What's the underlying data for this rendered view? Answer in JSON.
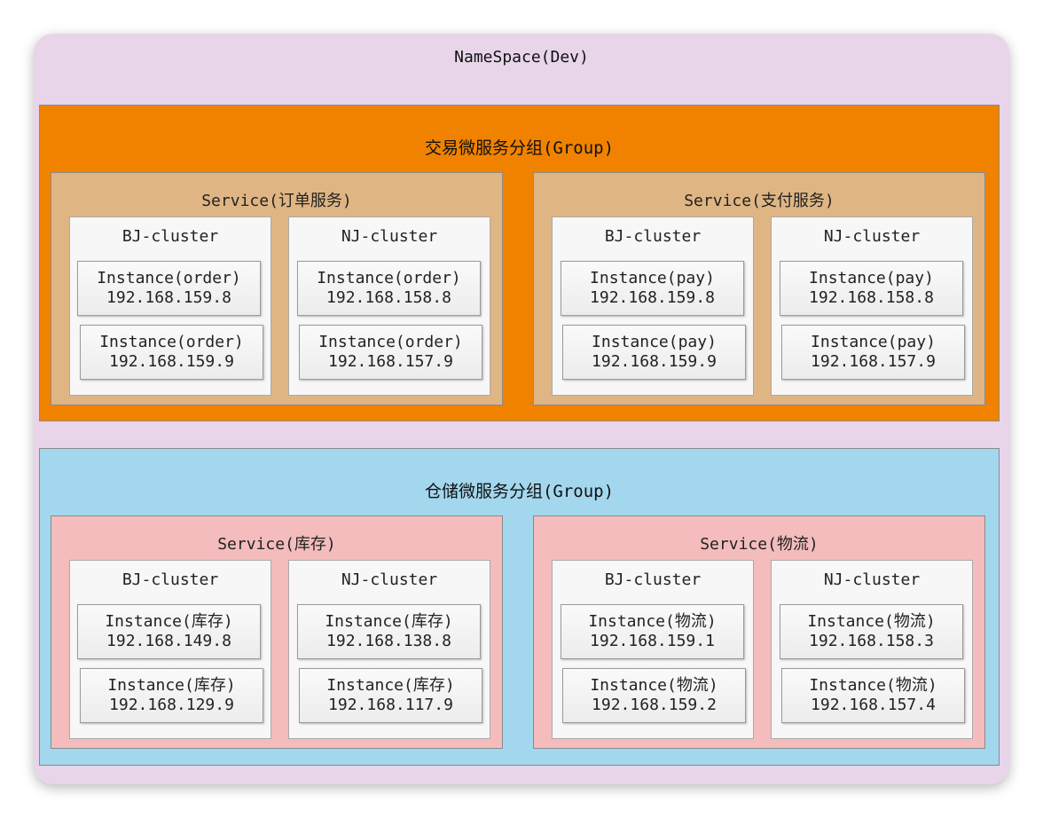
{
  "namespace": {
    "title": "NameSpace(Dev)"
  },
  "groups": [
    {
      "title": "交易微服务分组(Group)",
      "color": "#f08200",
      "service_color": "#dfb584",
      "services": [
        {
          "title": "Service(订单服务)",
          "clusters": [
            {
              "title": "BJ-cluster",
              "instances": [
                {
                  "name": "Instance(order)",
                  "ip": "192.168.159.8"
                },
                {
                  "name": "Instance(order)",
                  "ip": "192.168.159.9"
                }
              ]
            },
            {
              "title": "NJ-cluster",
              "instances": [
                {
                  "name": "Instance(order)",
                  "ip": "192.168.158.8"
                },
                {
                  "name": "Instance(order)",
                  "ip": "192.168.157.9"
                }
              ]
            }
          ]
        },
        {
          "title": "Service(支付服务)",
          "clusters": [
            {
              "title": "BJ-cluster",
              "instances": [
                {
                  "name": "Instance(pay)",
                  "ip": "192.168.159.8"
                },
                {
                  "name": "Instance(pay)",
                  "ip": "192.168.159.9"
                }
              ]
            },
            {
              "title": "NJ-cluster",
              "instances": [
                {
                  "name": "Instance(pay)",
                  "ip": "192.168.158.8"
                },
                {
                  "name": "Instance(pay)",
                  "ip": "192.168.157.9"
                }
              ]
            }
          ]
        }
      ]
    },
    {
      "title": "仓储微服务分组(Group)",
      "color": "#a3d7ee",
      "service_color": "#f4bcbc",
      "services": [
        {
          "title": "Service(库存)",
          "clusters": [
            {
              "title": "BJ-cluster",
              "instances": [
                {
                  "name": "Instance(库存)",
                  "ip": "192.168.149.8"
                },
                {
                  "name": "Instance(库存)",
                  "ip": "192.168.129.9"
                }
              ]
            },
            {
              "title": "NJ-cluster",
              "instances": [
                {
                  "name": "Instance(库存)",
                  "ip": "192.168.138.8"
                },
                {
                  "name": "Instance(库存)",
                  "ip": "192.168.117.9"
                }
              ]
            }
          ]
        },
        {
          "title": "Service(物流)",
          "clusters": [
            {
              "title": "BJ-cluster",
              "instances": [
                {
                  "name": "Instance(物流)",
                  "ip": "192.168.159.1"
                },
                {
                  "name": "Instance(物流)",
                  "ip": "192.168.159.2"
                }
              ]
            },
            {
              "title": "NJ-cluster",
              "instances": [
                {
                  "name": "Instance(物流)",
                  "ip": "192.168.158.3"
                },
                {
                  "name": "Instance(物流)",
                  "ip": "192.168.157.4"
                }
              ]
            }
          ]
        }
      ]
    }
  ]
}
